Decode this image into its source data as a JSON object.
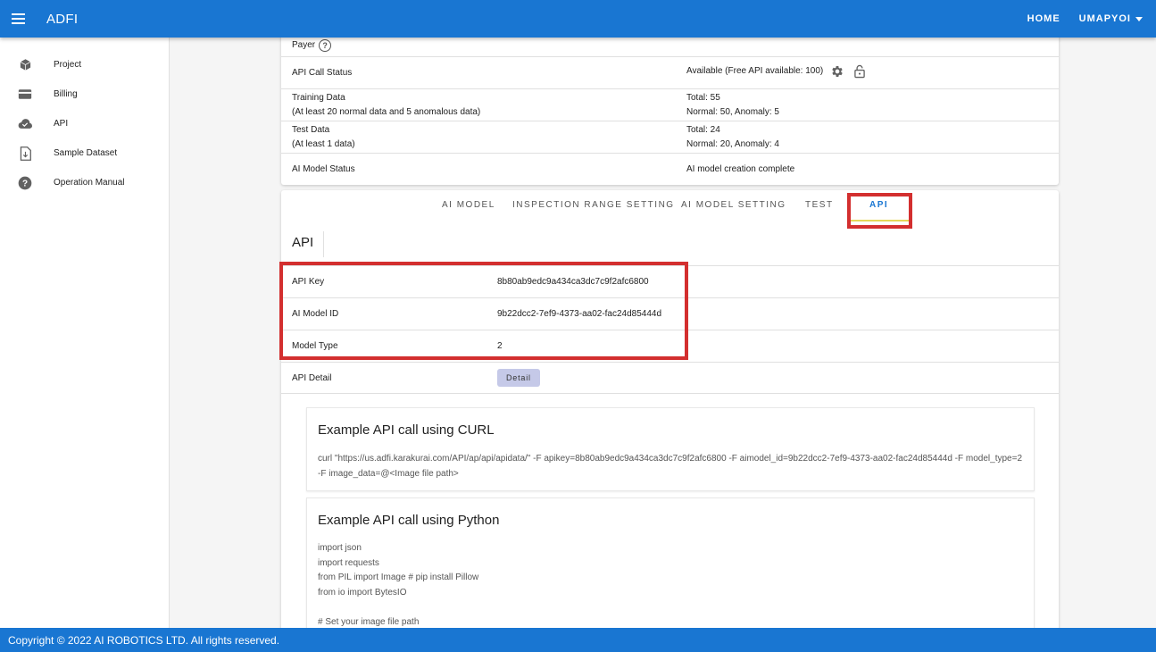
{
  "appbar": {
    "title": "ADFI",
    "home_label": "HOME",
    "user_label": "UMAPYOI"
  },
  "sidebar": {
    "items": [
      {
        "label": "Project",
        "icon": "cube-icon"
      },
      {
        "label": "Billing",
        "icon": "credit-card-icon"
      },
      {
        "label": "API",
        "icon": "cloud-check-icon"
      },
      {
        "label": "Sample Dataset",
        "icon": "file-download-icon"
      },
      {
        "label": "Operation Manual",
        "icon": "help-circle-icon"
      }
    ]
  },
  "status": {
    "payer_label": "Payer",
    "api_call_label": "API Call Status",
    "api_call_value": "Available (Free API available: 100)",
    "training_label_1": "Training Data",
    "training_label_2": "(At least 20 normal data and 5 anomalous data)",
    "training_value_1": "Total: 55",
    "training_value_2": "Normal: 50, Anomaly: 5",
    "test_label_1": "Test Data",
    "test_label_2": "(At least 1 data)",
    "test_value_1": "Total: 24",
    "test_value_2": "Normal: 20, Anomaly: 4",
    "model_status_label": "AI Model Status",
    "model_status_value": "AI model creation complete"
  },
  "tabs": [
    {
      "label": "AI MODEL"
    },
    {
      "label": "INSPECTION RANGE SETTING"
    },
    {
      "label": "AI MODEL SETTING"
    },
    {
      "label": "TEST"
    },
    {
      "label": "API"
    }
  ],
  "api": {
    "heading": "API",
    "key_label": "API Key",
    "key_value": "8b80ab9edc9a434ca3dc7c9f2afc6800",
    "model_id_label": "AI Model ID",
    "model_id_value": "9b22dcc2-7ef9-4373-aa02-fac24d85444d",
    "model_type_label": "Model Type",
    "model_type_value": "2",
    "detail_label": "API Detail",
    "detail_button": "Detail"
  },
  "examples": {
    "curl_title": "Example API call using CURL",
    "curl_body": "curl \"https://us.adfi.karakurai.com/API/ap/api/apidata/\" -F apikey=8b80ab9edc9a434ca3dc7c9f2afc6800 -F aimodel_id=9b22dcc2-7ef9-4373-aa02-fac24d85444d -F model_type=2 -F image_data=@<Image file path>",
    "python_title": "Example API call using Python",
    "python_body": "import json\nimport requests\nfrom PIL import Image # pip install Pillow\nfrom io import BytesIO\n\n# Set your image file path"
  },
  "footer": {
    "copyright": "Copyright © 2022 AI ROBOTICS LTD. All rights reserved."
  },
  "colors": {
    "primary": "#1976d2",
    "highlight": "#d32f2f",
    "tab_indicator": "#e6d85a",
    "detail_button": "#c5c9e8"
  }
}
